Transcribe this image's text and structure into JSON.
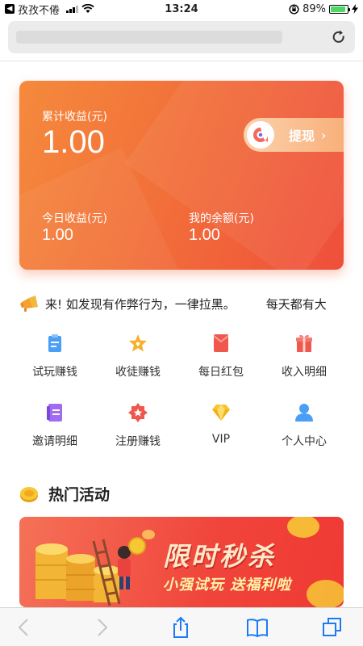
{
  "status_bar": {
    "carrier": "孜孜不倦",
    "time": "13:24",
    "battery_percent": "89%",
    "battery_level": 0.89
  },
  "url_bar": {
    "url": ""
  },
  "earnings": {
    "total_label": "累计收益(元)",
    "total_value": "1.00",
    "withdraw_label": "提现",
    "today_label": "今日收益(元)",
    "today_value": "1.00",
    "balance_label": "我的余额(元)",
    "balance_value": "1.00"
  },
  "notice": {
    "text_1": "来!  如发现有作弊行为，一律拉黑。",
    "text_2": "每天都有大"
  },
  "menu": {
    "items": [
      {
        "label": "试玩赚钱",
        "icon": "clipboard-icon"
      },
      {
        "label": "收徒赚钱",
        "icon": "star-icon"
      },
      {
        "label": "每日红包",
        "icon": "red-envelope-icon"
      },
      {
        "label": "收入明细",
        "icon": "gift-icon"
      },
      {
        "label": "邀请明细",
        "icon": "document-icon"
      },
      {
        "label": "注册赚钱",
        "icon": "star-badge-icon"
      },
      {
        "label": "VIP",
        "icon": "diamond-icon"
      },
      {
        "label": "个人中心",
        "icon": "user-icon"
      }
    ]
  },
  "hot_events": {
    "title": "热门活动",
    "banner_title": "限时秒杀",
    "banner_subtitle": "小强试玩 送福利啦"
  },
  "colors": {
    "card_start": "#f58a3c",
    "card_end": "#ef4f3b",
    "accent": "#f2703a"
  }
}
